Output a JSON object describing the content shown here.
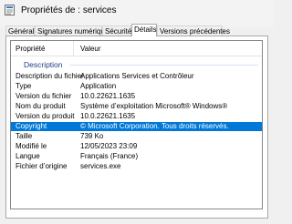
{
  "window": {
    "title": "Propriétés de : services"
  },
  "tabs": [
    {
      "label": "Général"
    },
    {
      "label": "Signatures numériques"
    },
    {
      "label": "Sécurité"
    },
    {
      "label": "Détails"
    },
    {
      "label": "Versions précédentes"
    }
  ],
  "active_tab": "Détails",
  "details": {
    "header": {
      "property": "Propriété",
      "value": "Valeur"
    },
    "group_label": "Description",
    "rows": [
      {
        "key": "Description du fichier",
        "value": "Applications Services et Contrôleur"
      },
      {
        "key": "Type",
        "value": "Application"
      },
      {
        "key": "Version du fichier",
        "value": "10.0.22621.1635"
      },
      {
        "key": "Nom du produit",
        "value": "Système d’exploitation Microsoft® Windows®"
      },
      {
        "key": "Version du produit",
        "value": "10.0.22621.1635"
      },
      {
        "key": "Copyright",
        "value": "© Microsoft Corporation. Tous droits réservés."
      },
      {
        "key": "Taille",
        "value": "739 Ko"
      },
      {
        "key": "Modifié le",
        "value": "12/05/2023 23:09"
      },
      {
        "key": "Langue",
        "value": "Français (France)"
      },
      {
        "key": "Fichier d’origine",
        "value": "services.exe"
      }
    ],
    "selected_row": "Copyright"
  },
  "colors": {
    "selection": "#0078d7",
    "group_label": "#1e3e8a"
  }
}
